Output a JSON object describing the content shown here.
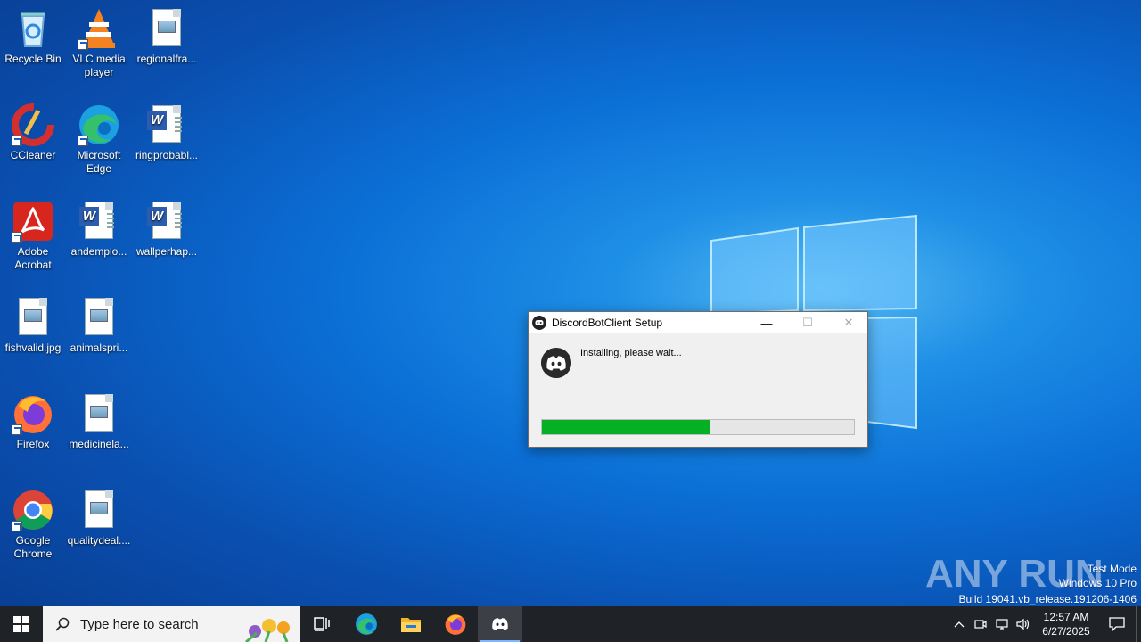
{
  "desktop": {
    "icons": [
      {
        "label": "Recycle Bin",
        "icon": "recycle-bin-icon"
      },
      {
        "label": "VLC media player",
        "icon": "vlc-icon"
      },
      {
        "label": "regionalfra...",
        "icon": "image-file-icon"
      },
      {
        "label": "CCleaner",
        "icon": "ccleaner-icon"
      },
      {
        "label": "Microsoft Edge",
        "icon": "edge-icon"
      },
      {
        "label": "ringprobabl...",
        "icon": "word-doc-icon"
      },
      {
        "label": "Adobe Acrobat",
        "icon": "acrobat-icon"
      },
      {
        "label": "andemplo...",
        "icon": "word-doc-icon"
      },
      {
        "label": "wallperhap...",
        "icon": "word-doc-icon"
      },
      {
        "label": "fishvalid.jpg",
        "icon": "image-file-icon"
      },
      {
        "label": "animalspri...",
        "icon": "image-file-icon"
      },
      {
        "label": "Firefox",
        "icon": "firefox-icon"
      },
      {
        "label": "medicinela...",
        "icon": "image-file-icon"
      },
      {
        "label": "Google Chrome",
        "icon": "chrome-icon"
      },
      {
        "label": "qualitydeal....",
        "icon": "image-file-icon"
      }
    ]
  },
  "dialog": {
    "title": "DiscordBotClient Setup",
    "message": "Installing, please wait...",
    "progress": 0.54,
    "minimize_glyph": "—",
    "maximize_glyph": "☐",
    "close_glyph": "✕",
    "accent_color": "#06b025"
  },
  "watermark": {
    "brand": "ANY RUN",
    "line1": "Test Mode",
    "line2": "Windows 10 Pro",
    "line3": "Build 19041.vb_release.191206-1406"
  },
  "taskbar": {
    "search_placeholder": "Type here to search",
    "apps": [
      "task-view-icon",
      "edge-icon",
      "file-explorer-icon",
      "firefox-icon",
      "discord-icon"
    ],
    "clock_time": "12:57 AM",
    "clock_date": "6/27/2025",
    "tray_icons": [
      "chevron-up-icon",
      "meet-now-icon",
      "network-icon",
      "volume-icon"
    ]
  }
}
